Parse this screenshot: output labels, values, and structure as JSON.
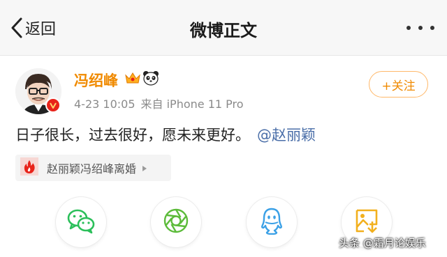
{
  "nav": {
    "back_label": "返回",
    "title": "微博正文"
  },
  "post": {
    "author": "冯绍峰",
    "date": "4-23 10:05",
    "source": "来自 iPhone 11 Pro",
    "follow_label": "+关注",
    "text": "日子很长，过去很好，愿未来更好。",
    "mention": "@赵丽颖",
    "topic_label": "赵丽颖冯绍峰离婚"
  },
  "share": {
    "items": [
      "wechat-icon",
      "moments-icon",
      "qq-icon",
      "qzone-icon"
    ]
  },
  "watermark": {
    "text": "头条 @霜月论娱乐"
  },
  "colors": {
    "accent": "#f08a00",
    "link": "#4a6ea8",
    "badge": "#e8231a"
  }
}
